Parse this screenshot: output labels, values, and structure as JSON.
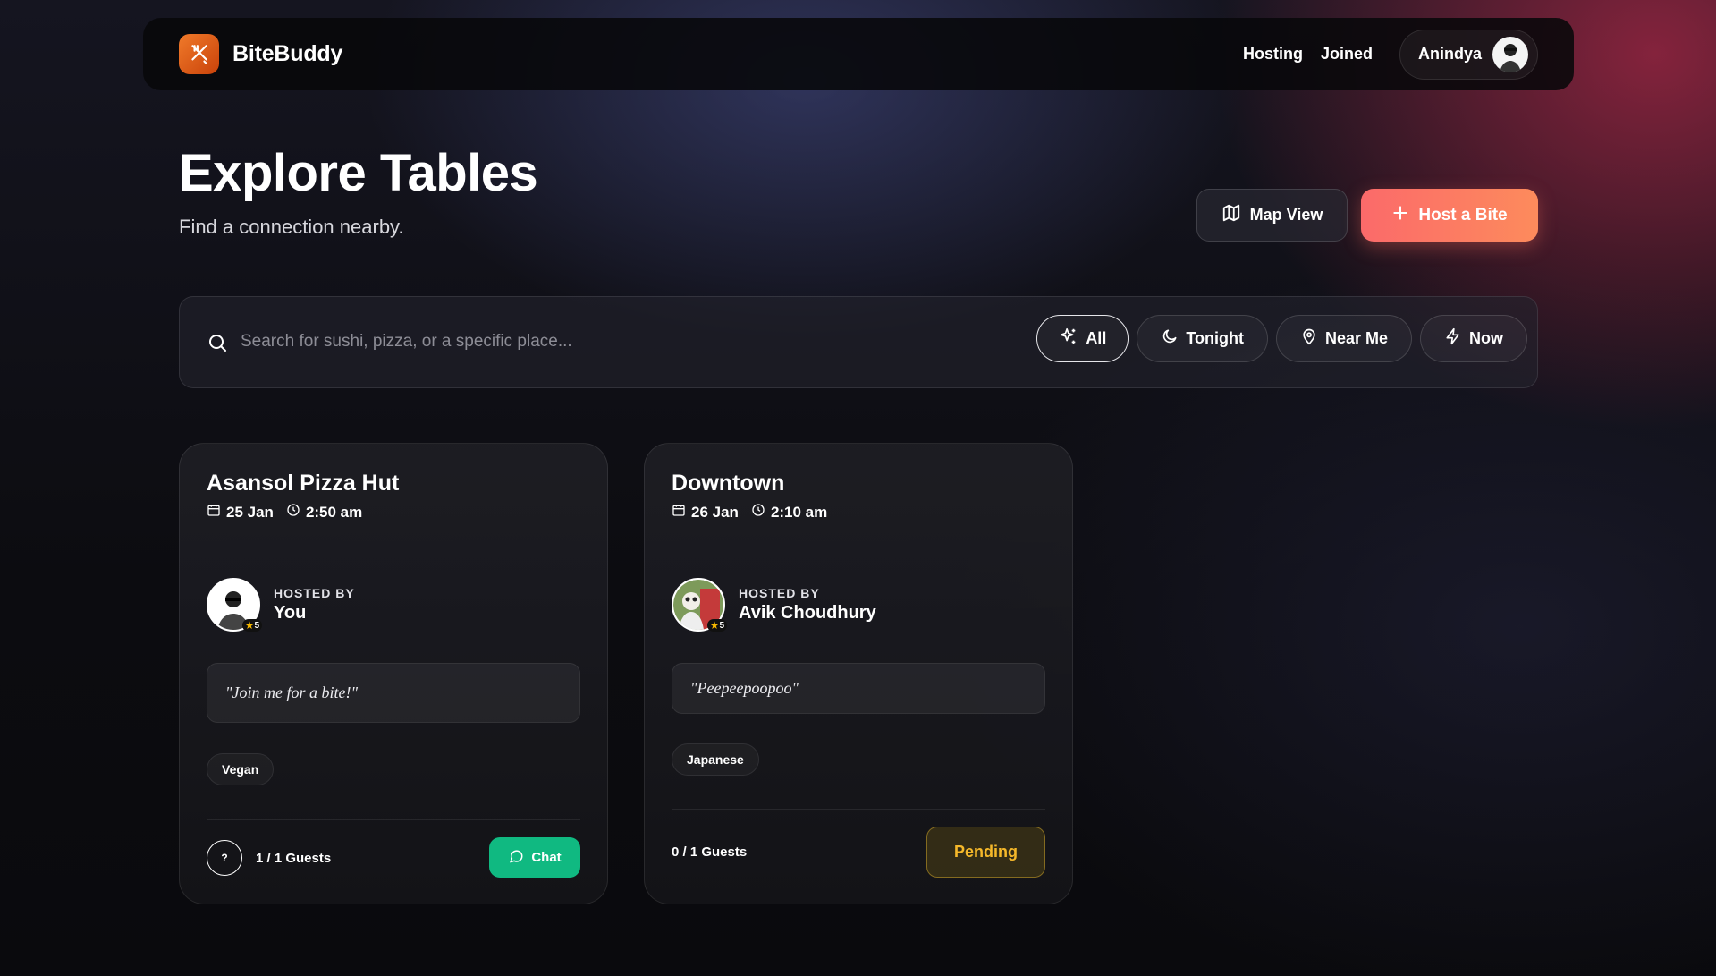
{
  "nav": {
    "brand": "BiteBuddy",
    "links": [
      "Hosting",
      "Joined"
    ],
    "user_name": "Anindya"
  },
  "header": {
    "title": "Explore Tables",
    "subtitle": "Find a connection nearby."
  },
  "actions": {
    "map_view": "Map View",
    "host": "Host a Bite"
  },
  "search": {
    "placeholder": "Search for sushi, pizza, or a specific place...",
    "filters": [
      {
        "label": "All",
        "icon": "sparkles-icon",
        "active": true
      },
      {
        "label": "Tonight",
        "icon": "moon-icon",
        "active": false
      },
      {
        "label": "Near Me",
        "icon": "map-pin-icon",
        "active": false
      },
      {
        "label": "Now",
        "icon": "bolt-icon",
        "active": false
      }
    ]
  },
  "cards": [
    {
      "title": "Asansol Pizza Hut",
      "date": "25 Jan",
      "time": "2:50 am",
      "hosted_by_label": "HOSTED BY",
      "host": "You",
      "rating": "5",
      "quote": "\"Join me for a bite!\"",
      "tag": "Vegan",
      "guest_badge": "?",
      "guests": "1 / 1 Guests",
      "action": "Chat"
    },
    {
      "title": "Downtown",
      "date": "26 Jan",
      "time": "2:10 am",
      "hosted_by_label": "HOSTED BY",
      "host": "Avik Choudhury",
      "rating": "5",
      "quote": "\"Peepeepoopoo\"",
      "tag": "Japanese",
      "guests": "0 / 1 Guests",
      "action": "Pending"
    }
  ],
  "colors": {
    "accent_gradient_start": "#fb6a6a",
    "accent_gradient_end": "#fd8b5c",
    "chat_green": "#10b981",
    "pending_amber": "#f5b82a",
    "logo_orange": "#f07a2a"
  }
}
